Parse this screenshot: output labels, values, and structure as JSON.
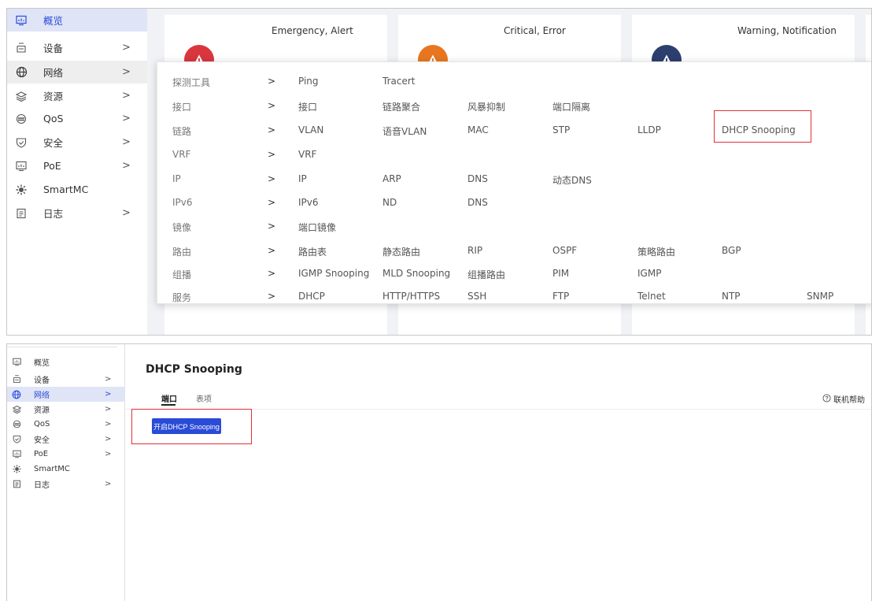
{
  "sidebar": {
    "items": [
      {
        "label": "概览",
        "icon": "dashboard-icon",
        "chevron": ""
      },
      {
        "label": "设备",
        "icon": "device-icon",
        "chevron": ">"
      },
      {
        "label": "网络",
        "icon": "network-globe-icon",
        "chevron": ">"
      },
      {
        "label": "资源",
        "icon": "layers-icon",
        "chevron": ">"
      },
      {
        "label": "QoS",
        "icon": "qos-icon",
        "chevron": ">"
      },
      {
        "label": "安全",
        "icon": "shield-icon",
        "chevron": ">"
      },
      {
        "label": "PoE",
        "icon": "poe-icon",
        "chevron": ">"
      },
      {
        "label": "SmartMC",
        "icon": "gear-cluster-icon",
        "chevron": ""
      },
      {
        "label": "日志",
        "icon": "log-icon",
        "chevron": ">"
      }
    ]
  },
  "cards": [
    {
      "title": "Emergency, Alert",
      "color": "#d9363e"
    },
    {
      "title": "Critical, Error",
      "color": "#e8761f"
    },
    {
      "title": "Warning, Notification",
      "color": "#2d3f6e"
    }
  ],
  "menu": {
    "arrow": ">",
    "rows": [
      {
        "category": "探测工具",
        "items": [
          "Ping",
          "Tracert"
        ]
      },
      {
        "category": "接口",
        "items": [
          "接口",
          "链路聚合",
          "风暴抑制",
          "端口隔离"
        ]
      },
      {
        "category": "链路",
        "items": [
          "VLAN",
          "语音VLAN",
          "MAC",
          "STP",
          "LLDP",
          "DHCP Snooping"
        ]
      },
      {
        "category": "VRF",
        "items": [
          "VRF"
        ]
      },
      {
        "category": "IP",
        "items": [
          "IP",
          "ARP",
          "DNS",
          "动态DNS"
        ]
      },
      {
        "category": "IPv6",
        "items": [
          "IPv6",
          "ND",
          "DNS"
        ]
      },
      {
        "category": "镜像",
        "items": [
          "端口镜像"
        ]
      },
      {
        "category": "路由",
        "items": [
          "路由表",
          "静态路由",
          "RIP",
          "OSPF",
          "策略路由",
          "BGP"
        ]
      },
      {
        "category": "组播",
        "items": [
          "IGMP Snooping",
          "MLD Snooping",
          "组播路由",
          "PIM",
          "IGMP"
        ]
      },
      {
        "category": "服务",
        "items": [
          "DHCP",
          "HTTP/HTTPS",
          "SSH",
          "FTP",
          "Telnet",
          "NTP",
          "SNMP"
        ]
      }
    ]
  },
  "page": {
    "title": "DHCP Snooping",
    "tabs": [
      "端口",
      "表项"
    ],
    "help": "联机帮助",
    "enable_button": "开启DHCP Snooping"
  },
  "colors": {
    "accent": "#2a4bd7",
    "highlight": "#e0303a",
    "active_bg": "#dfe4f7"
  }
}
